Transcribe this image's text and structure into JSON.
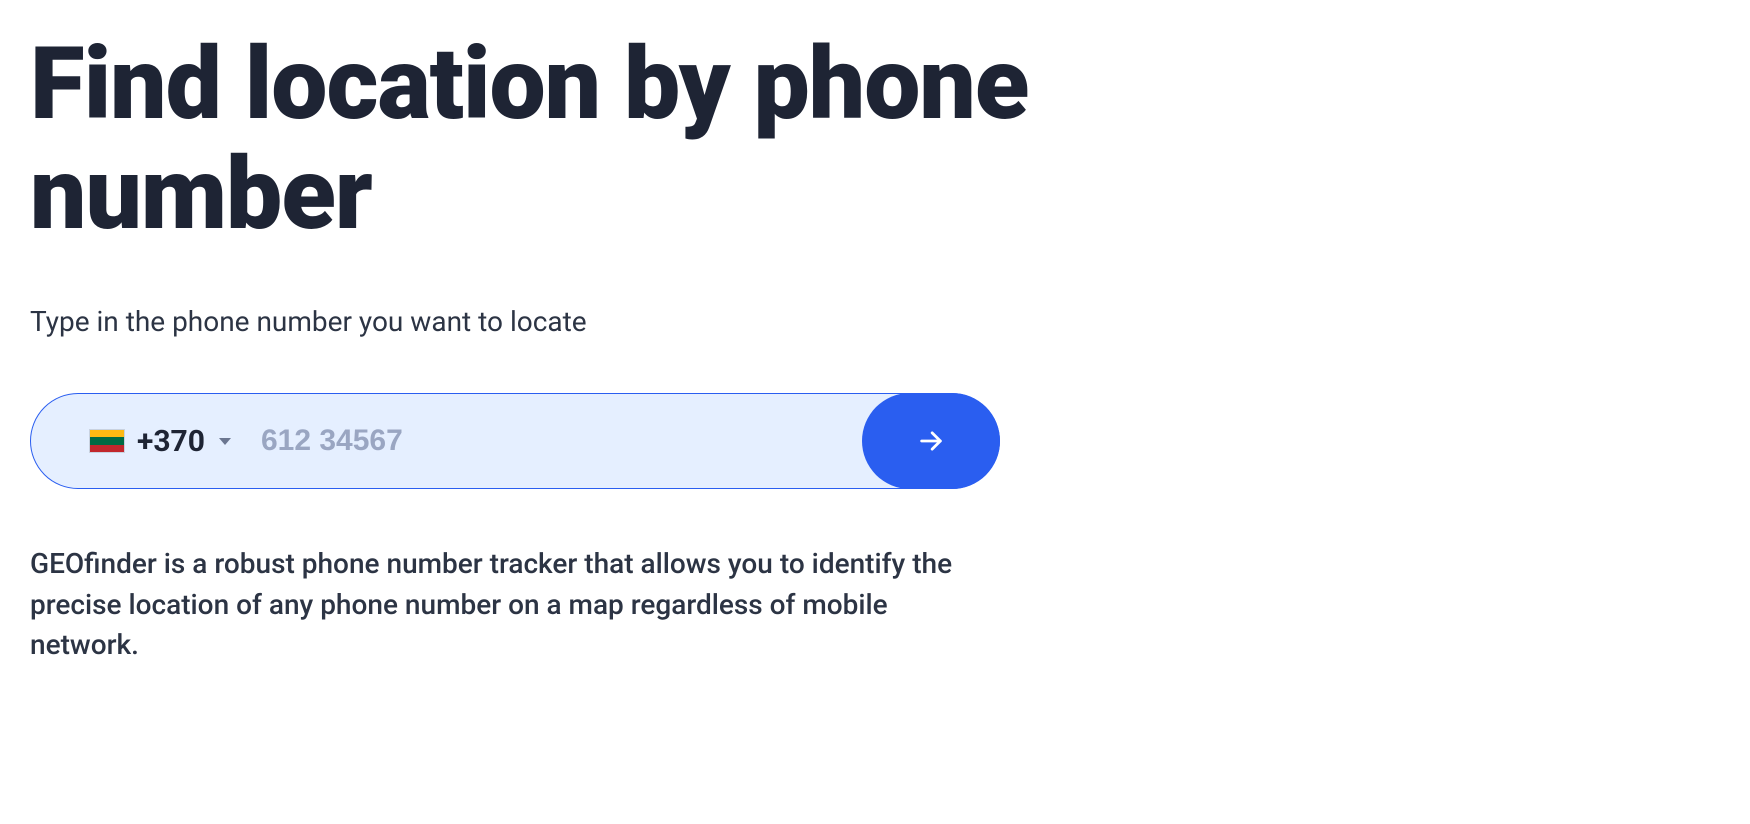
{
  "hero": {
    "title": "Find location by phone number",
    "subtitle": "Type in the phone number you want to locate",
    "description": "GEOfinder is a robust phone number tracker that allows you to identify the precise location of any phone number on a map regardless of mobile network."
  },
  "phone_form": {
    "country_flag": "lithuania",
    "dial_code": "+370",
    "placeholder": "612 34567",
    "value": ""
  },
  "colors": {
    "accent": "#2a5ef0",
    "input_bg": "#e5efff",
    "text_dark": "#1e2434",
    "placeholder": "#9aa6c2"
  }
}
